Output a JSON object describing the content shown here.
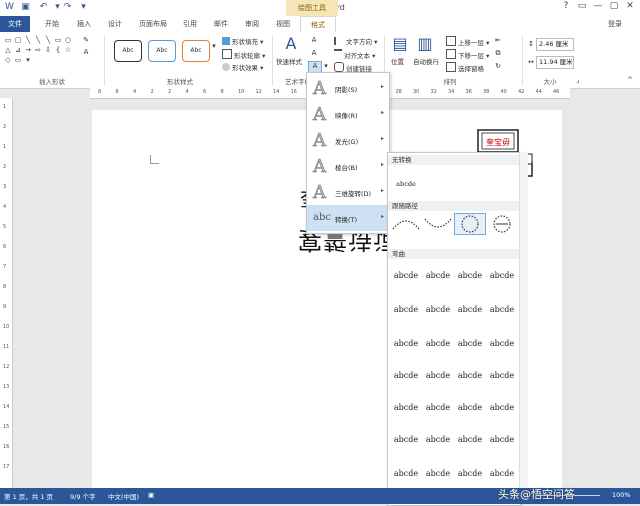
{
  "window": {
    "title": "文档1 - Word",
    "contextual_header": "绘图工具",
    "controls": [
      "?",
      "▭",
      "—",
      "▢",
      "✕"
    ]
  },
  "tabs": [
    "文件",
    "开始",
    "插入",
    "设计",
    "页面布局",
    "引用",
    "邮件",
    "审阅",
    "视图",
    "格式"
  ],
  "account": {
    "login": "登录"
  },
  "ribbon": {
    "groups": {
      "insert_shapes": "插入形状",
      "shape_styles": "形状样式",
      "art_styles": "艺术字样",
      "arrange": "排列",
      "size": "大小"
    },
    "style_samples": [
      "Abc",
      "Abc",
      "Abc"
    ],
    "shape_fill": "形状填充",
    "shape_outline": "形状轮廓",
    "shape_effects": "形状效果",
    "quick_styles": "快速样式",
    "text_direction": "文字方向",
    "align_text": "对齐文本",
    "create_link": "创建链接",
    "position": "位置",
    "wrap_text": "自动换行",
    "bring_forward": "上移一层",
    "send_backward": "下移一层",
    "selection_pane": "选择窗格",
    "height": "2.46 厘米",
    "width": "11.94 厘米"
  },
  "ruler_ticks": [
    "8",
    "6",
    "4",
    "2",
    "2",
    "4",
    "6",
    "8",
    "10",
    "12",
    "14",
    "16",
    "18",
    "20",
    "22",
    "24",
    "26",
    "28",
    "30",
    "32",
    "34",
    "36",
    "38",
    "40",
    "42",
    "44",
    "46"
  ],
  "vruler_ticks": [
    "1",
    "2",
    "1",
    "2",
    "3",
    "4",
    "5",
    "6",
    "7",
    "8",
    "9",
    "10",
    "11",
    "12",
    "13",
    "14",
    "15",
    "16",
    "17"
  ],
  "document": {
    "mirrored_text": "宴誓诗词的",
    "partial_text": "奎",
    "stamp_text": "奎宝毋"
  },
  "effects_menu": [
    {
      "label": "阴影(S)",
      "glyph": "A"
    },
    {
      "label": "映像(R)",
      "glyph": "A"
    },
    {
      "label": "发光(G)",
      "glyph": "A"
    },
    {
      "label": "棱台(B)",
      "glyph": "A"
    },
    {
      "label": "三维旋转(D)",
      "glyph": "A"
    },
    {
      "label": "转换(T)",
      "glyph": "abc"
    }
  ],
  "gallery": {
    "no_transform_head": "无转换",
    "no_transform_sample": "abcde",
    "follow_path_head": "跟随路径",
    "warp_head": "弯曲",
    "sample": "abcde"
  },
  "statusbar": {
    "page": "第 1 页，共 1 页",
    "words": "9/9 个字",
    "language": "中文(中国)",
    "zoom": "100%",
    "watermark": "头条@悟空问答"
  }
}
